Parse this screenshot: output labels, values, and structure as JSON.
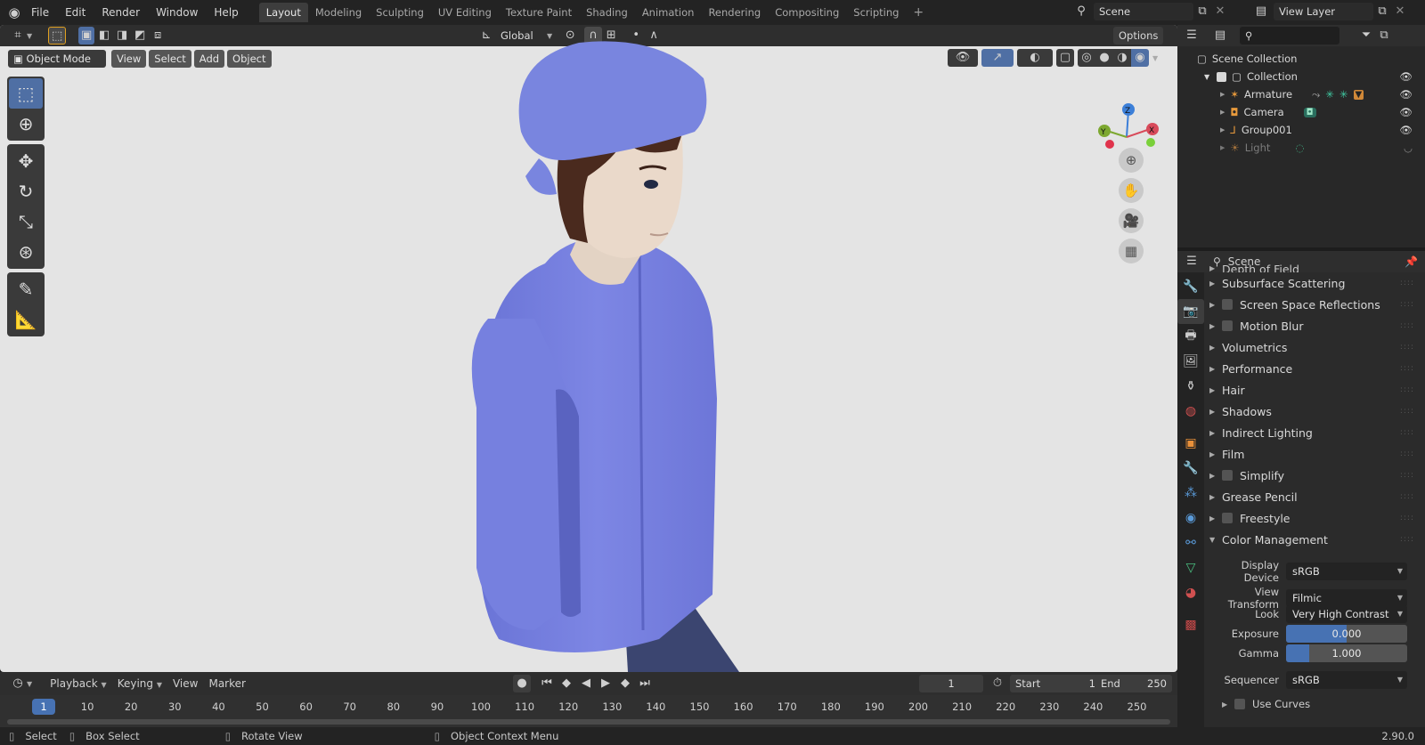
{
  "menu": {
    "items": [
      "File",
      "Edit",
      "Render",
      "Window",
      "Help"
    ]
  },
  "workspaces": [
    {
      "label": "Layout",
      "active": true
    },
    {
      "label": "Modeling",
      "active": false
    },
    {
      "label": "Sculpting",
      "active": false
    },
    {
      "label": "UV Editing",
      "active": false
    },
    {
      "label": "Texture Paint",
      "active": false
    },
    {
      "label": "Shading",
      "active": false
    },
    {
      "label": "Animation",
      "active": false
    },
    {
      "label": "Rendering",
      "active": false
    },
    {
      "label": "Compositing",
      "active": false
    },
    {
      "label": "Scripting",
      "active": false
    }
  ],
  "scene_field": "Scene",
  "view_layer_field": "View Layer",
  "viewport_header": {
    "transform_orientation": "Global",
    "options_label": "Options"
  },
  "viewport_sub": {
    "mode": "Object Mode",
    "menus": [
      "View",
      "Select",
      "Add",
      "Object"
    ]
  },
  "gizmo": {
    "z": "Z",
    "y": "Y",
    "x": "X"
  },
  "outliner": {
    "root": "Scene Collection",
    "collection": "Collection",
    "objects": [
      {
        "name": "Armature",
        "dimmed": false
      },
      {
        "name": "Camera",
        "dimmed": false
      },
      {
        "name": "Group001",
        "dimmed": false
      },
      {
        "name": "Light",
        "dimmed": true
      }
    ]
  },
  "properties": {
    "header_title": "Scene",
    "cut_panel": "Depth of Field",
    "panels": [
      {
        "label": "Subsurface Scattering",
        "checkbox": false
      },
      {
        "label": "Screen Space Reflections",
        "checkbox": true
      },
      {
        "label": "Motion Blur",
        "checkbox": true
      },
      {
        "label": "Volumetrics",
        "checkbox": false
      },
      {
        "label": "Performance",
        "checkbox": false
      },
      {
        "label": "Hair",
        "checkbox": false
      },
      {
        "label": "Shadows",
        "checkbox": false
      },
      {
        "label": "Indirect Lighting",
        "checkbox": false
      },
      {
        "label": "Film",
        "checkbox": false
      },
      {
        "label": "Simplify",
        "checkbox": true
      },
      {
        "label": "Grease Pencil",
        "checkbox": false
      },
      {
        "label": "Freestyle",
        "checkbox": true
      }
    ],
    "color_management": {
      "label": "Color Management",
      "display_device_label": "Display Device",
      "display_device": "sRGB",
      "view_transform_label": "View Transform",
      "view_transform": "Filmic",
      "look_label": "Look",
      "look": "Very High Contrast",
      "exposure_label": "Exposure",
      "exposure": "0.000",
      "gamma_label": "Gamma",
      "gamma": "1.000",
      "sequencer_label": "Sequencer",
      "sequencer": "sRGB",
      "use_curves": "Use Curves"
    }
  },
  "timeline_header": {
    "menus": [
      "Playback",
      "Keying",
      "View",
      "Marker"
    ],
    "current_frame": "1",
    "start_label": "Start",
    "start": "1",
    "end_label": "End",
    "end": "250"
  },
  "timeline": {
    "current": "1",
    "frames": [
      "10",
      "20",
      "30",
      "40",
      "50",
      "60",
      "70",
      "80",
      "90",
      "100",
      "110",
      "120",
      "130",
      "140",
      "150",
      "160",
      "170",
      "180",
      "190",
      "200",
      "210",
      "220",
      "230",
      "240",
      "250"
    ]
  },
  "status": {
    "select": "Select",
    "box_select": "Box Select",
    "rotate_view": "Rotate View",
    "context_menu": "Object Context Menu",
    "version": "2.90.0"
  }
}
